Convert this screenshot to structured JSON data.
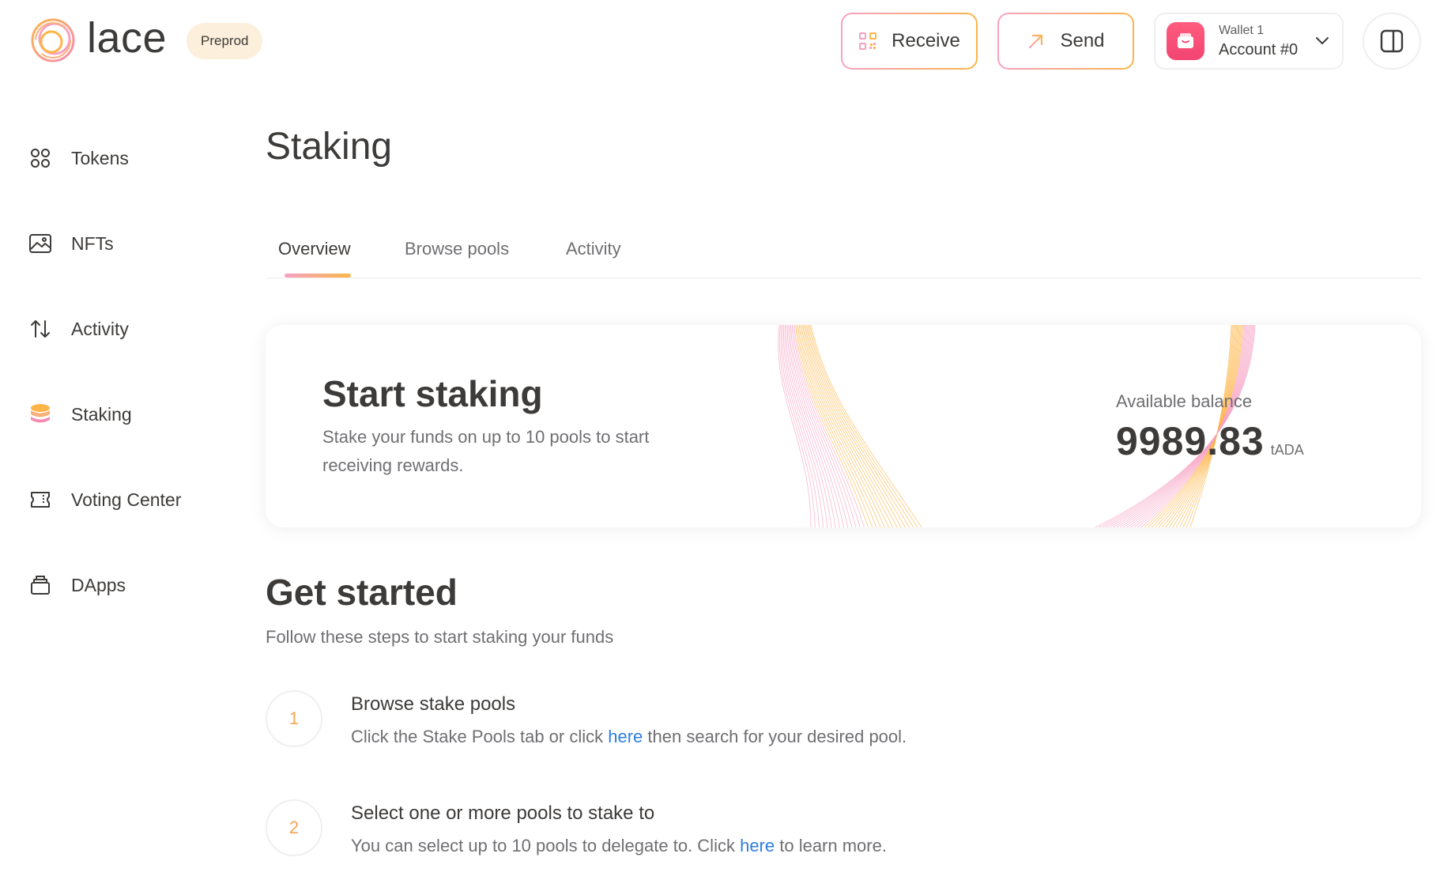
{
  "app": {
    "name": "lace",
    "network_badge": "Preprod"
  },
  "header": {
    "receive_label": "Receive",
    "send_label": "Send",
    "wallet_name": "Wallet 1",
    "account_name": "Account #0"
  },
  "sidebar": {
    "items": [
      {
        "label": "Tokens",
        "icon": "grid-icon"
      },
      {
        "label": "NFTs",
        "icon": "image-icon"
      },
      {
        "label": "Activity",
        "icon": "arrows-up-down-icon"
      },
      {
        "label": "Staking",
        "icon": "coins-stack-icon",
        "active": true
      },
      {
        "label": "Voting Center",
        "icon": "ticket-icon"
      },
      {
        "label": "DApps",
        "icon": "stack-icon"
      }
    ]
  },
  "page": {
    "title": "Staking",
    "tabs": [
      {
        "label": "Overview",
        "active": true
      },
      {
        "label": "Browse pools"
      },
      {
        "label": "Activity"
      }
    ]
  },
  "start_card": {
    "title": "Start staking",
    "description": "Stake your funds on up to 10 pools to start receiving rewards.",
    "balance_label": "Available balance",
    "balance_value": "9989.83",
    "balance_unit": "tADA"
  },
  "get_started": {
    "title": "Get started",
    "subtitle": "Follow these steps to start staking your funds",
    "steps": [
      {
        "number": "1",
        "title": "Browse stake pools",
        "desc_before": "Click the Stake Pools tab or click ",
        "link": "here",
        "desc_after": " then search for your desired pool."
      },
      {
        "number": "2",
        "title": "Select one or more pools to stake to",
        "desc_before": "You can select up to 10 pools to delegate to. Click ",
        "link": "here",
        "desc_after": " to learn more."
      }
    ]
  },
  "colors": {
    "accent_pink": "#f7a1c3",
    "accent_orange": "#fdb54a",
    "link": "#2d7ee0",
    "step_number": "#f9a351"
  }
}
